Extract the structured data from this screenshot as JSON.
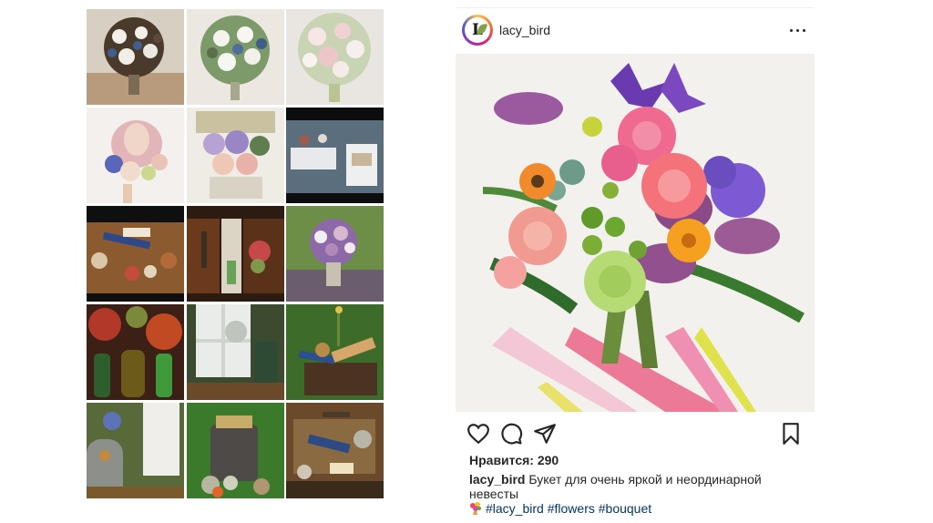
{
  "post": {
    "username": "lacy_bird",
    "avatar_letter": "L",
    "likes_text": "Нравится: 290",
    "caption_user": "lacy_bird",
    "caption_text": "Букет для очень яркой и неординарной невесты",
    "hashtags": [
      "#lacy_bird",
      "#flowers",
      "#bouquet"
    ],
    "icons": {
      "like": "heart-icon",
      "comment": "comment-icon",
      "share": "paper-plane-icon",
      "save": "bookmark-icon",
      "more": "more-dots-icon"
    }
  },
  "grid": {
    "rows": 5,
    "columns": 3,
    "tiles": [
      "bouquet-white-blue",
      "bouquet-green-white",
      "bouquet-pink-white",
      "bouquet-protea",
      "bouquet-lilac-basket",
      "dessert-table",
      "picnic-table",
      "garden-decor",
      "bouquet-purple-stump",
      "bottles-autumn",
      "window-decor",
      "basket-grass",
      "bird-cage",
      "stump-decor",
      "tray-decor"
    ]
  },
  "colors": {
    "text": "#262626",
    "hashtag": "#00376b",
    "background": "#ffffff"
  }
}
